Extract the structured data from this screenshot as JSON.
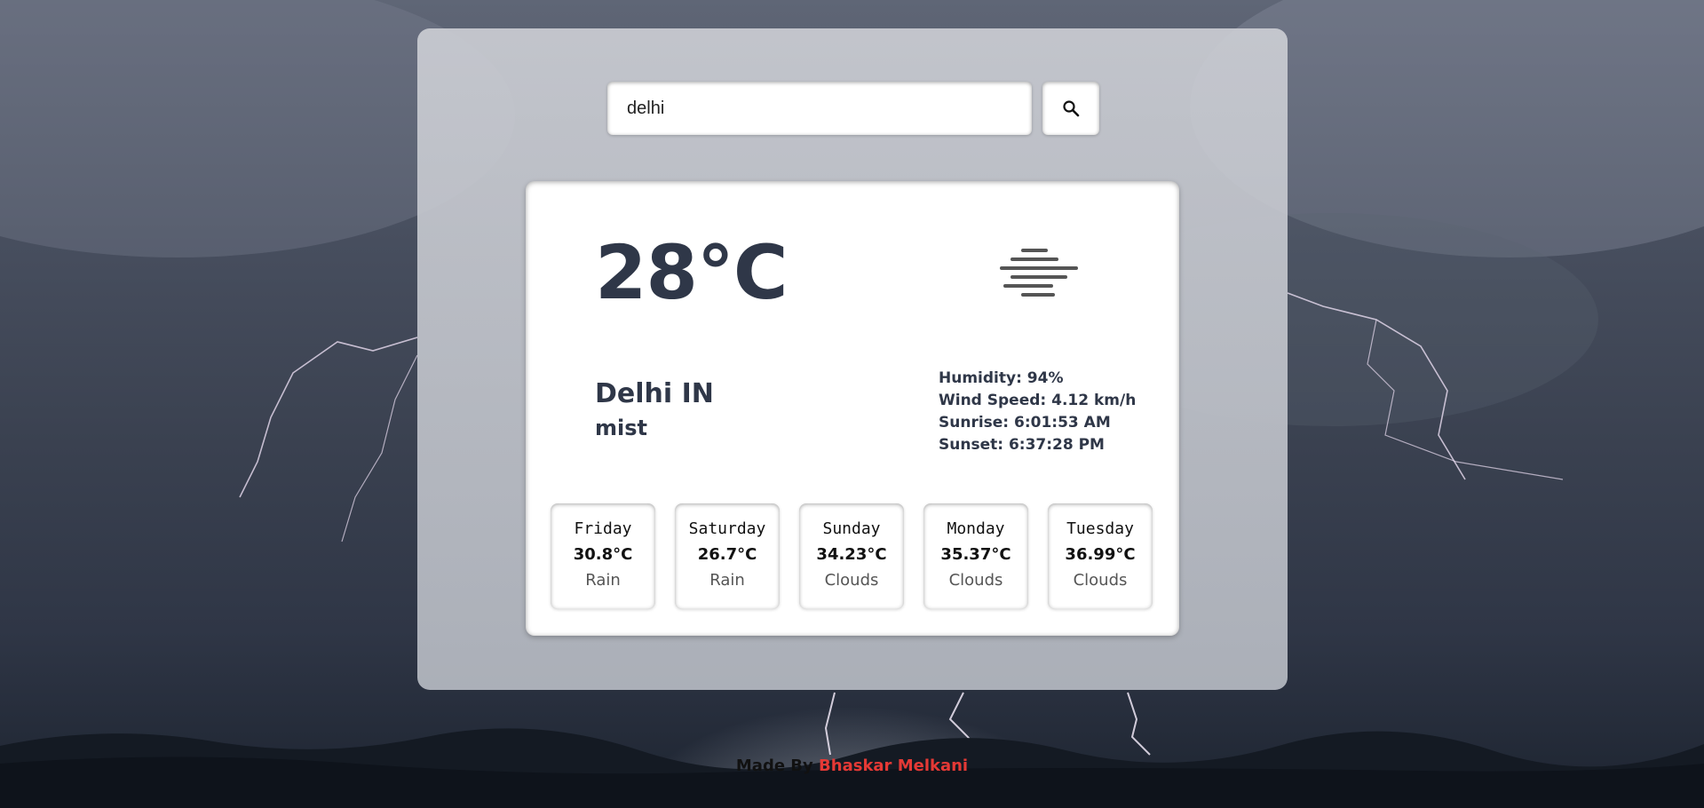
{
  "search": {
    "value": "delhi"
  },
  "current": {
    "temperature": "28°C",
    "location": "Delhi IN",
    "condition": "mist",
    "icon": "mist-icon",
    "humidity": "Humidity: 94%",
    "wind_speed": "Wind Speed: 4.12 km/h",
    "sunrise": "Sunrise: 6:01:53 AM",
    "sunset": "Sunset: 6:37:28 PM"
  },
  "forecast": [
    {
      "day": "Friday",
      "temp": "30.8°C",
      "desc": "Rain"
    },
    {
      "day": "Saturday",
      "temp": "26.7°C",
      "desc": "Rain"
    },
    {
      "day": "Sunday",
      "temp": "34.23°C",
      "desc": "Clouds"
    },
    {
      "day": "Monday",
      "temp": "35.37°C",
      "desc": "Clouds"
    },
    {
      "day": "Tuesday",
      "temp": "36.99°C",
      "desc": "Clouds"
    }
  ],
  "footer": {
    "prefix": "Made By",
    "author": "Bhaskar Melkani"
  },
  "colors": {
    "accent": "#e53935",
    "text": "#2f3748"
  }
}
